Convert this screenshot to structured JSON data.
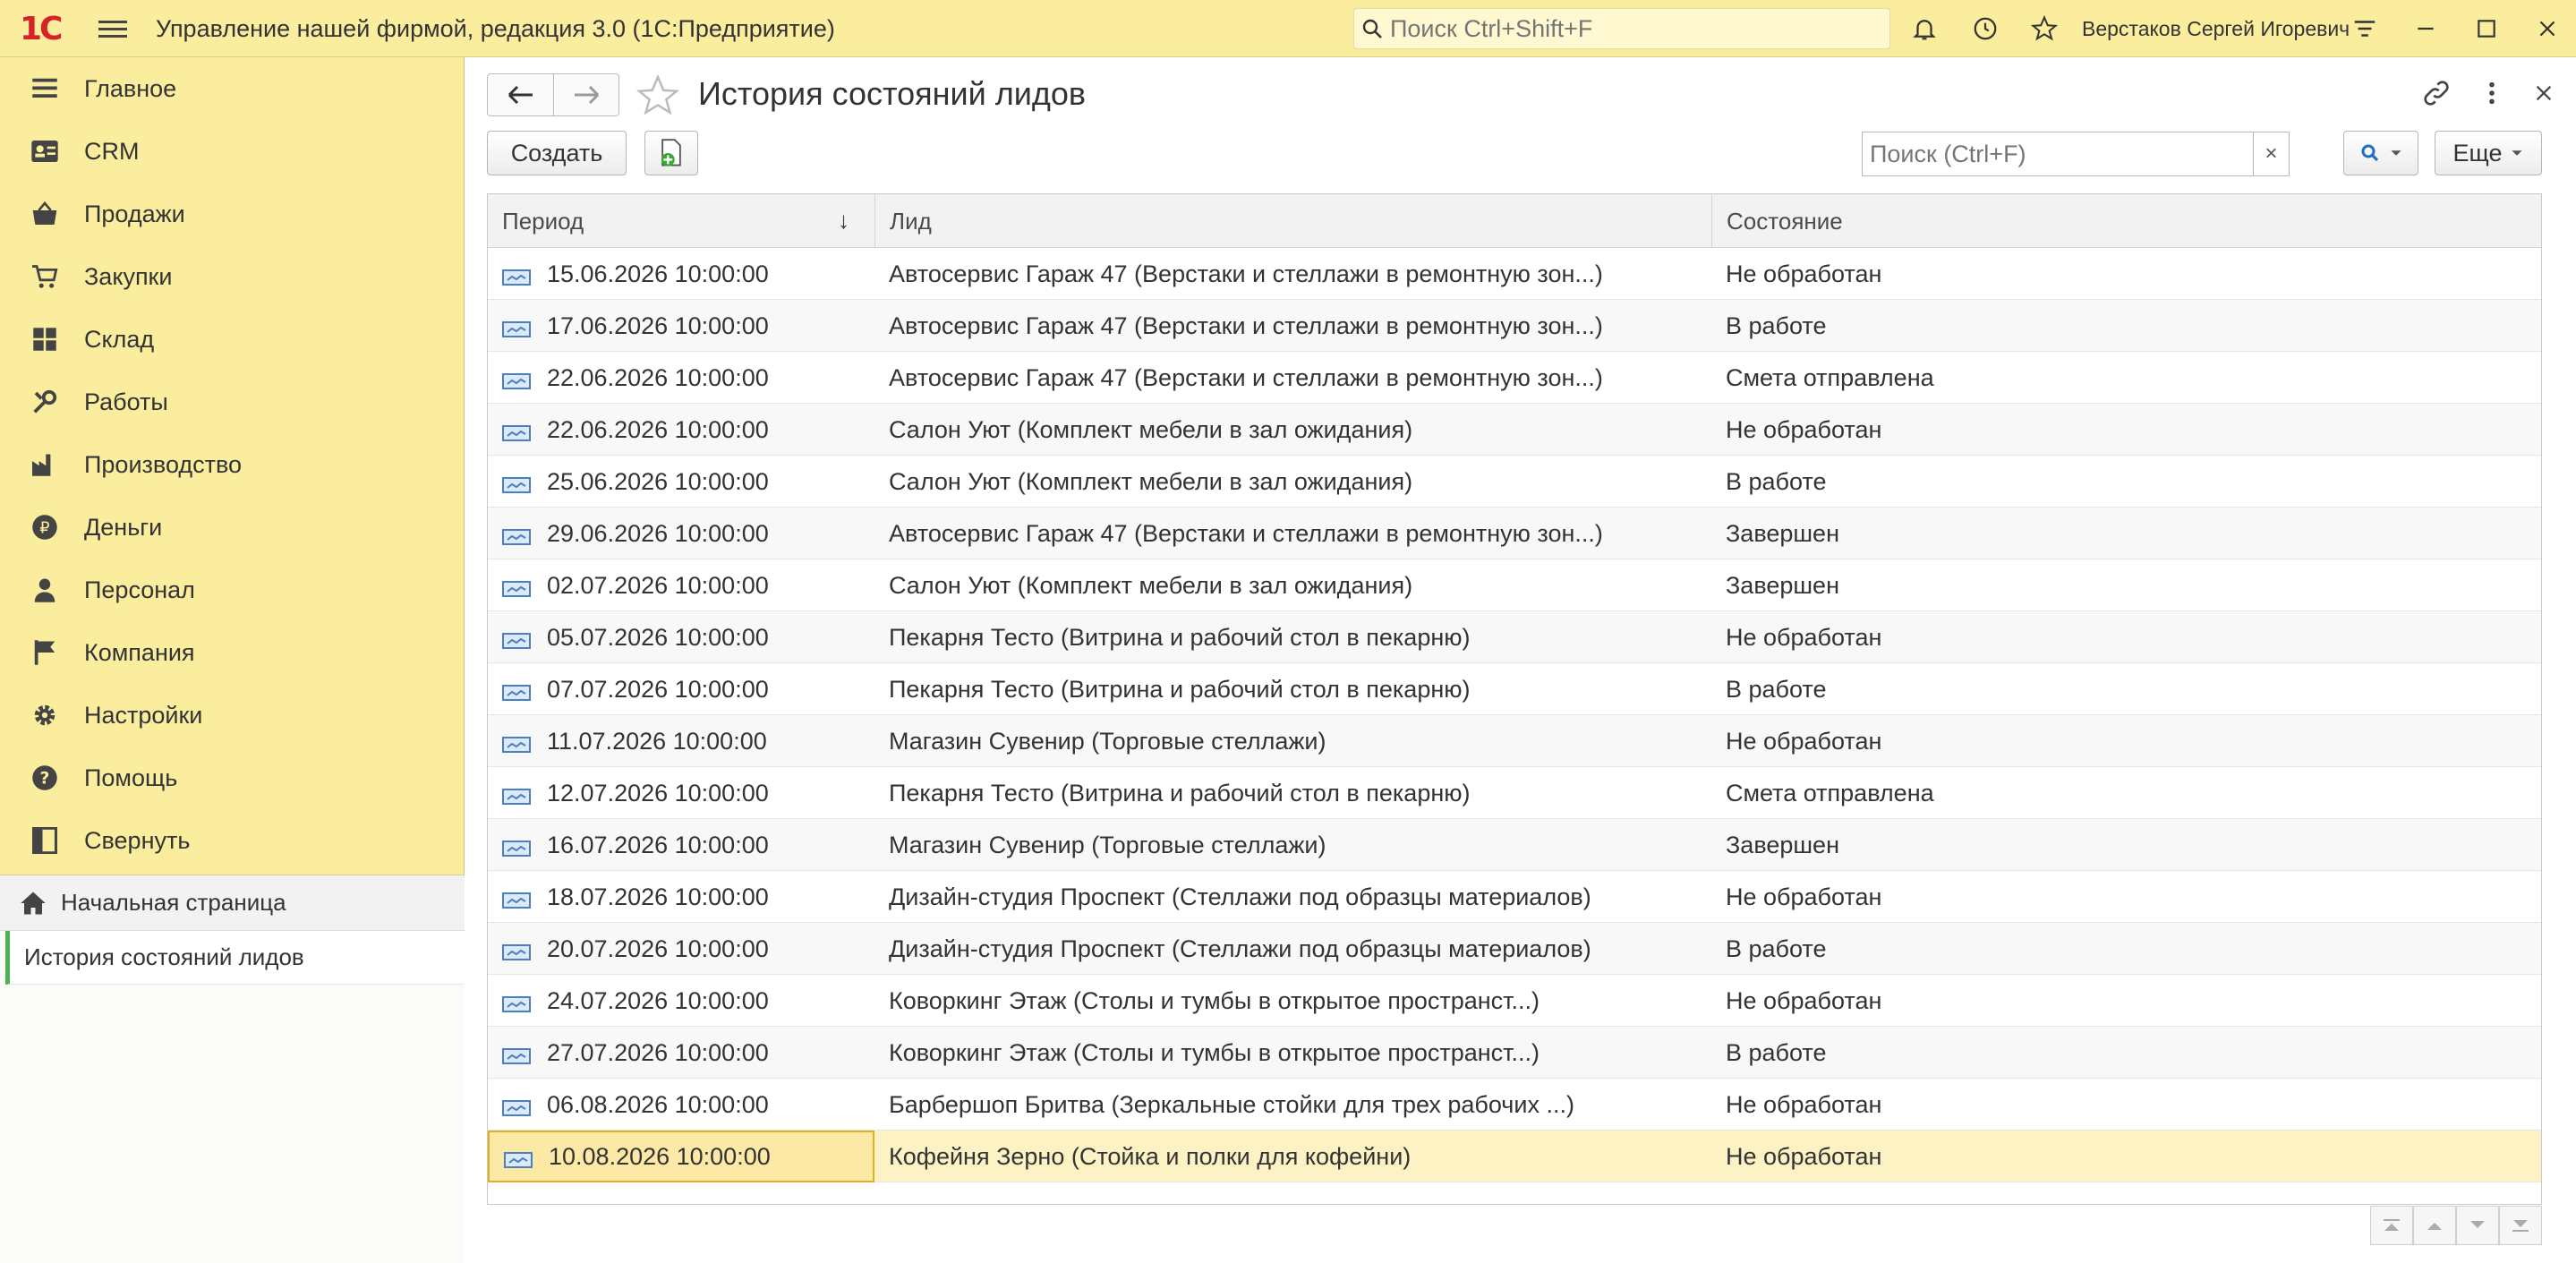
{
  "app": {
    "logo_text": "1С",
    "title": "Управление нашей фирмой, редакция 3.0  (1С:Предприятие)",
    "search_placeholder": "Поиск Ctrl+Shift+F",
    "user_name": "Верстаков Сергей Игоревич"
  },
  "sidebar": {
    "items": [
      {
        "label": "Главное",
        "icon": "list-icon"
      },
      {
        "label": "CRM",
        "icon": "contacts-icon"
      },
      {
        "label": "Продажи",
        "icon": "basket-icon"
      },
      {
        "label": "Закупки",
        "icon": "cart-icon"
      },
      {
        "label": "Склад",
        "icon": "warehouse-icon"
      },
      {
        "label": "Работы",
        "icon": "tools-icon"
      },
      {
        "label": "Производство",
        "icon": "factory-icon"
      },
      {
        "label": "Деньги",
        "icon": "ruble-icon"
      },
      {
        "label": "Персонал",
        "icon": "person-icon"
      },
      {
        "label": "Компания",
        "icon": "flag-icon"
      },
      {
        "label": "Настройки",
        "icon": "gear-icon"
      },
      {
        "label": "Помощь",
        "icon": "help-icon"
      },
      {
        "label": "Свернуть",
        "icon": "collapse-icon"
      }
    ],
    "home_label": "Начальная страница",
    "open_item_label": "История состояний лидов"
  },
  "main": {
    "title": "История состояний лидов",
    "create_label": "Создать",
    "search_placeholder": "Поиск (Ctrl+F)",
    "clear_label": "×",
    "more_label": "Еще",
    "columns": {
      "period": "Период",
      "lead": "Лид",
      "state": "Состояние"
    },
    "sort_indicator": "↓",
    "rows": [
      {
        "period": "15.06.2026 10:00:00",
        "lead": "Автосервис Гараж 47 (Верстаки и стеллажи в ремонтную зон...)",
        "state": "Не обработан"
      },
      {
        "period": "17.06.2026 10:00:00",
        "lead": "Автосервис Гараж 47 (Верстаки и стеллажи в ремонтную зон...)",
        "state": "В работе"
      },
      {
        "period": "22.06.2026 10:00:00",
        "lead": "Автосервис Гараж 47 (Верстаки и стеллажи в ремонтную зон...)",
        "state": "Смета отправлена"
      },
      {
        "period": "22.06.2026 10:00:00",
        "lead": "Салон Уют (Комплект мебели в зал ожидания)",
        "state": "Не обработан"
      },
      {
        "period": "25.06.2026 10:00:00",
        "lead": "Салон Уют (Комплект мебели в зал ожидания)",
        "state": "В работе"
      },
      {
        "period": "29.06.2026 10:00:00",
        "lead": "Автосервис Гараж 47 (Верстаки и стеллажи в ремонтную зон...)",
        "state": "Завершен"
      },
      {
        "period": "02.07.2026 10:00:00",
        "lead": "Салон Уют (Комплект мебели в зал ожидания)",
        "state": "Завершен"
      },
      {
        "period": "05.07.2026 10:00:00",
        "lead": "Пекарня Тесто (Витрина и рабочий стол в пекарню)",
        "state": "Не обработан"
      },
      {
        "period": "07.07.2026 10:00:00",
        "lead": "Пекарня Тесто (Витрина и рабочий стол в пекарню)",
        "state": "В работе"
      },
      {
        "period": "11.07.2026 10:00:00",
        "lead": "Магазин Сувенир (Торговые стеллажи)",
        "state": "Не обработан"
      },
      {
        "period": "12.07.2026 10:00:00",
        "lead": "Пекарня Тесто (Витрина и рабочий стол в пекарню)",
        "state": "Смета отправлена"
      },
      {
        "period": "16.07.2026 10:00:00",
        "lead": "Магазин Сувенир (Торговые стеллажи)",
        "state": "Завершен"
      },
      {
        "period": "18.07.2026 10:00:00",
        "lead": "Дизайн-студия Проспект (Стеллажи под образцы материалов)",
        "state": "Не обработан"
      },
      {
        "period": "20.07.2026 10:00:00",
        "lead": "Дизайн-студия Проспект (Стеллажи под образцы материалов)",
        "state": "В работе"
      },
      {
        "period": "24.07.2026 10:00:00",
        "lead": "Коворкинг Этаж (Столы и тумбы в открытое пространст...)",
        "state": "Не обработан"
      },
      {
        "period": "27.07.2026 10:00:00",
        "lead": "Коворкинг Этаж (Столы и тумбы в открытое пространст...)",
        "state": "В работе"
      },
      {
        "period": "06.08.2026 10:00:00",
        "lead": "Барбершоп Бритва (Зеркальные стойки для трех рабочих ...)",
        "state": "Не обработан"
      },
      {
        "period": "10.08.2026 10:00:00",
        "lead": "Кофейня Зерно (Стойка и полки для кофейни)",
        "state": "Не обработан"
      }
    ],
    "selected_row": 17
  },
  "colors": {
    "accent_yellow": "#fbed9e",
    "selected_row": "#fdf2c3",
    "logo_red": "#d6232a",
    "active_marker": "#4caf50"
  }
}
